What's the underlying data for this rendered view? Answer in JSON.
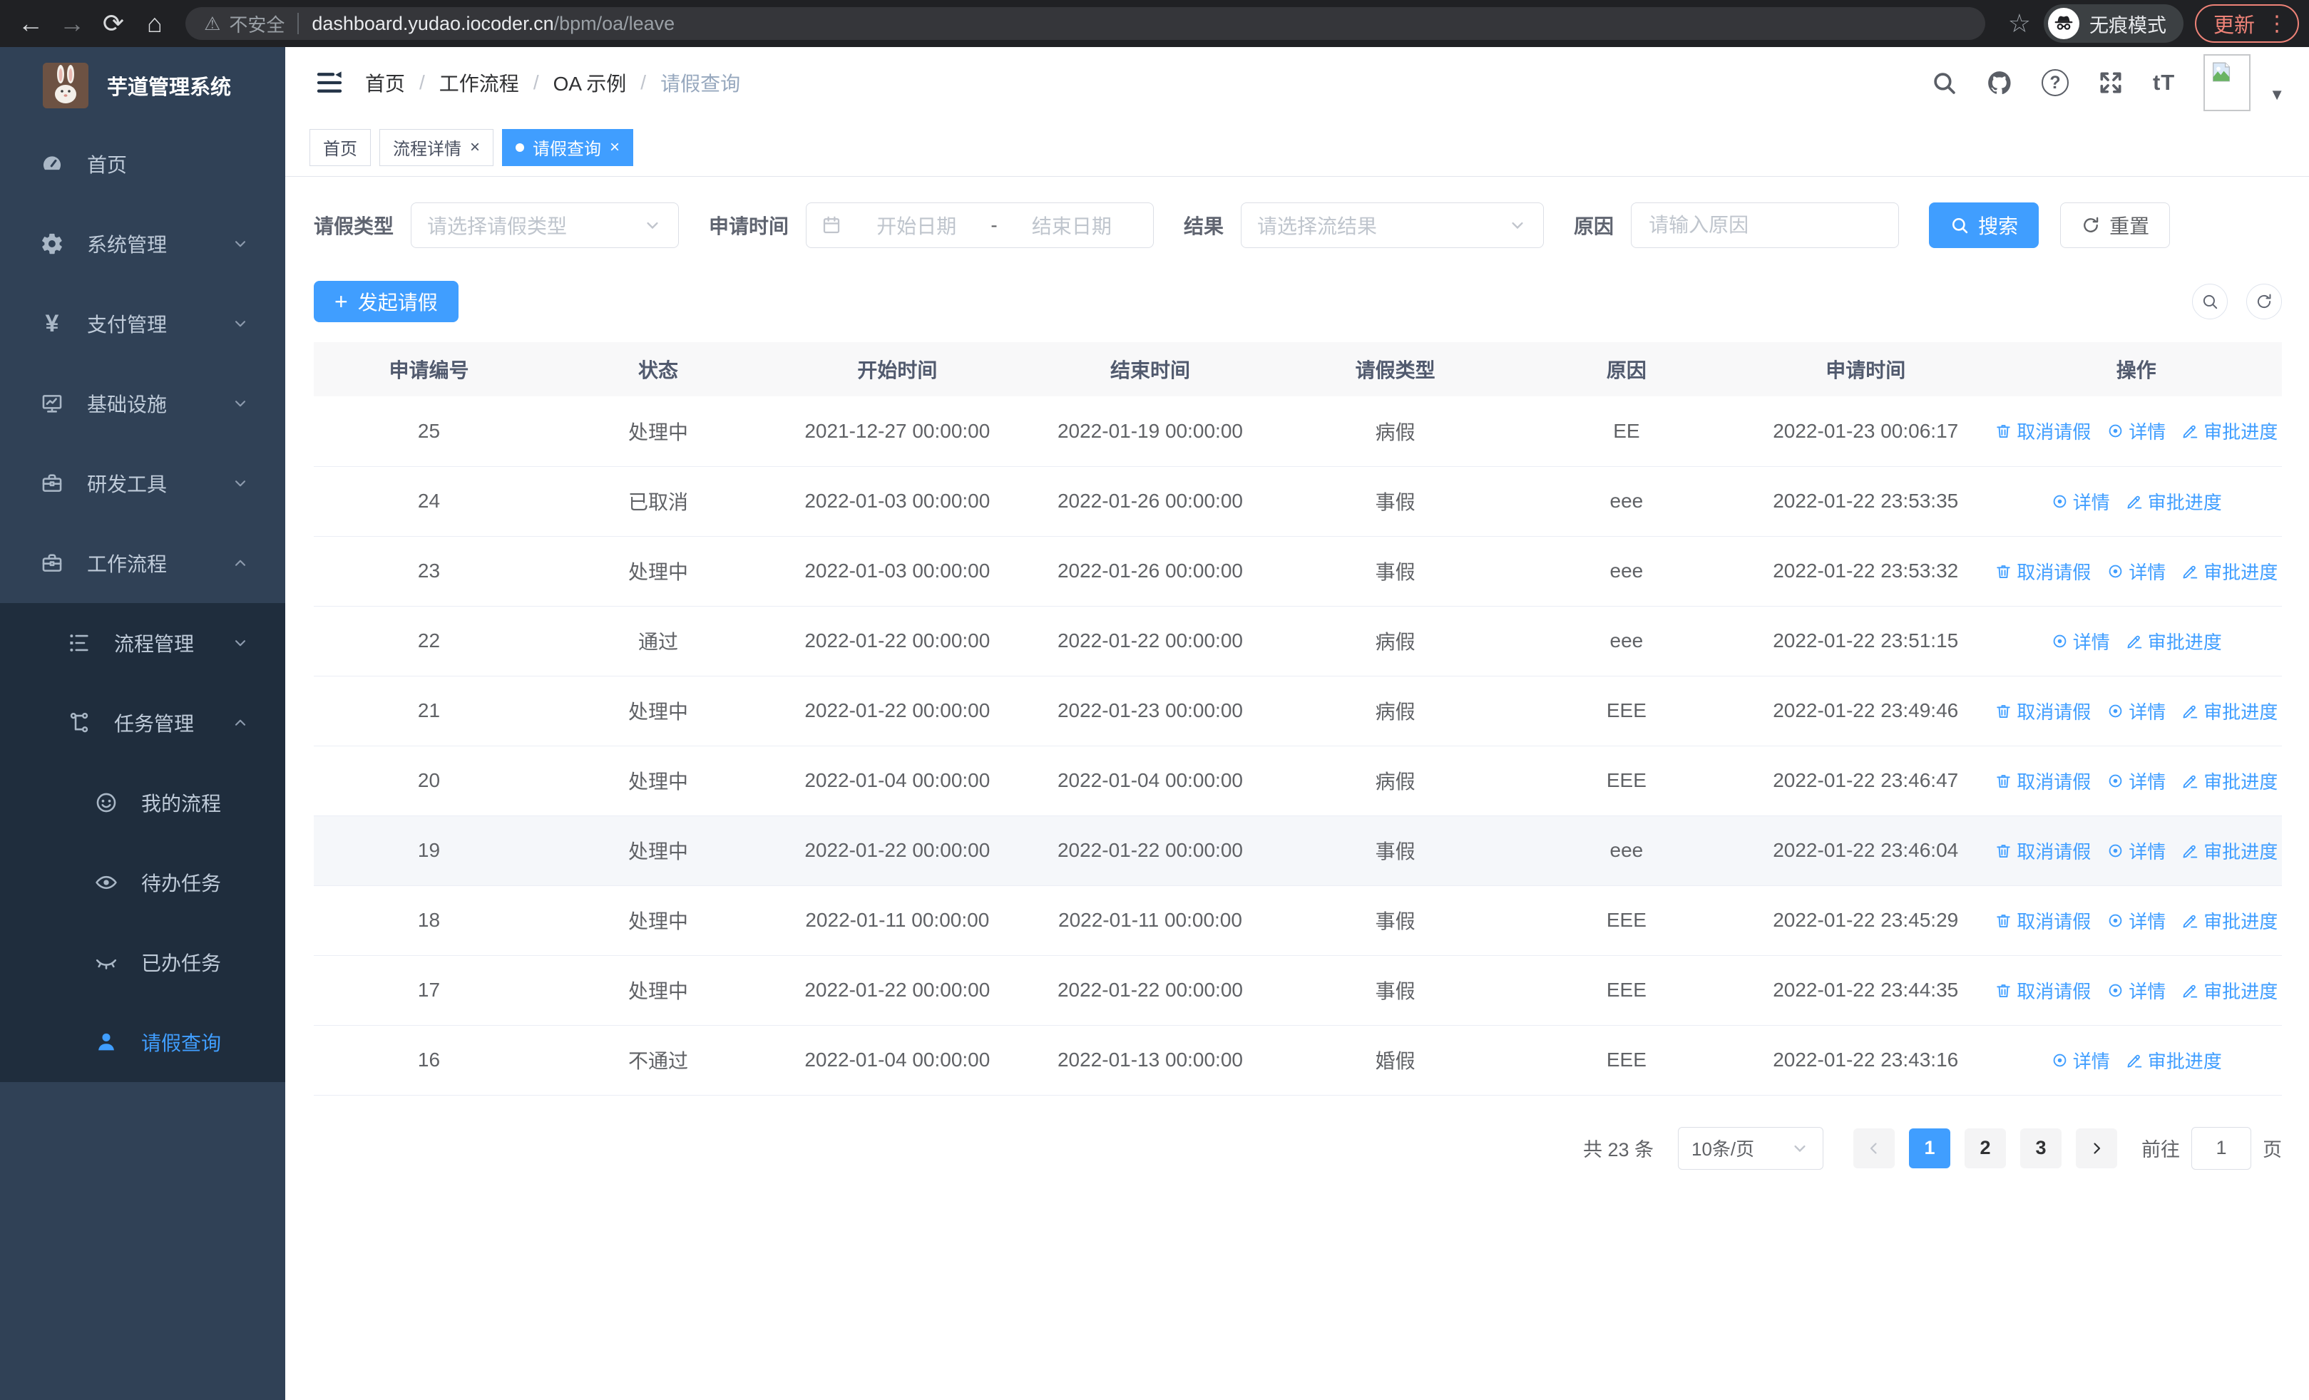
{
  "browser": {
    "security_label": "不安全",
    "url_host": "dashboard.yudao.iocoder.cn",
    "url_path": "/bpm/oa/leave",
    "incognito_label": "无痕模式",
    "update_label": "更新"
  },
  "sidebar": {
    "app_title": "芋道管理系统",
    "menu": [
      {
        "id": "home",
        "label": "首页",
        "icon": "dashboard-icon",
        "level": 0,
        "chev": null,
        "submenu": false,
        "active": false
      },
      {
        "id": "system",
        "label": "系统管理",
        "icon": "gear-icon",
        "level": 0,
        "chev": "down",
        "submenu": false,
        "active": false
      },
      {
        "id": "payment",
        "label": "支付管理",
        "icon": "yen-icon",
        "level": 0,
        "chev": "down",
        "submenu": false,
        "active": false
      },
      {
        "id": "infra",
        "label": "基础设施",
        "icon": "monitor-icon",
        "level": 0,
        "chev": "down",
        "submenu": false,
        "active": false
      },
      {
        "id": "devtools",
        "label": "研发工具",
        "icon": "toolbox-icon",
        "level": 0,
        "chev": "down",
        "submenu": false,
        "active": false
      },
      {
        "id": "workflow",
        "label": "工作流程",
        "icon": "toolbox-icon",
        "level": 0,
        "chev": "up",
        "submenu": false,
        "active": false
      },
      {
        "id": "process-mgmt",
        "label": "流程管理",
        "icon": "tree-icon",
        "level": 1,
        "chev": "down",
        "submenu": true,
        "active": false
      },
      {
        "id": "task-mgmt",
        "label": "任务管理",
        "icon": "share-icon",
        "level": 1,
        "chev": "up",
        "submenu": true,
        "active": false
      },
      {
        "id": "my-process",
        "label": "我的流程",
        "icon": "face-icon",
        "level": 2,
        "chev": null,
        "submenu": true,
        "active": false
      },
      {
        "id": "todo-tasks",
        "label": "待办任务",
        "icon": "eye-icon",
        "level": 2,
        "chev": null,
        "submenu": true,
        "active": false
      },
      {
        "id": "done-tasks",
        "label": "已办任务",
        "icon": "eye-closed-icon",
        "level": 2,
        "chev": null,
        "submenu": true,
        "active": false
      },
      {
        "id": "leave-query",
        "label": "请假查询",
        "icon": "user-icon",
        "level": 2,
        "chev": null,
        "submenu": true,
        "active": true
      }
    ]
  },
  "header": {
    "breadcrumb": [
      "首页",
      "工作流程",
      "OA 示例",
      "请假查询"
    ],
    "help_label": "?",
    "fontsize_label": "tT"
  },
  "tabs": [
    {
      "label": "首页",
      "active": false,
      "closable": false
    },
    {
      "label": "流程详情",
      "active": false,
      "closable": true
    },
    {
      "label": "请假查询",
      "active": true,
      "closable": true
    }
  ],
  "filters": {
    "leave_type_label": "请假类型",
    "leave_type_placeholder": "请选择请假类型",
    "apply_time_label": "申请时间",
    "start_date_placeholder": "开始日期",
    "date_separator": "-",
    "end_date_placeholder": "结束日期",
    "result_label": "结果",
    "result_placeholder": "请选择流结果",
    "reason_label": "原因",
    "reason_placeholder": "请输入原因",
    "search_label": "搜索",
    "reset_label": "重置"
  },
  "toolbar": {
    "create_label": "发起请假"
  },
  "table": {
    "columns": [
      "申请编号",
      "状态",
      "开始时间",
      "结束时间",
      "请假类型",
      "原因",
      "申请时间",
      "操作"
    ],
    "action_labels": {
      "cancel": "取消请假",
      "detail": "详情",
      "progress": "审批进度"
    },
    "rows": [
      {
        "id": "25",
        "status": "处理中",
        "start": "2021-12-27 00:00:00",
        "end": "2022-01-19 00:00:00",
        "type": "病假",
        "reason": "EE",
        "apply_time": "2022-01-23 00:06:17",
        "actions": [
          "cancel",
          "detail",
          "progress"
        ],
        "highlight": false
      },
      {
        "id": "24",
        "status": "已取消",
        "start": "2022-01-03 00:00:00",
        "end": "2022-01-26 00:00:00",
        "type": "事假",
        "reason": "eee",
        "apply_time": "2022-01-22 23:53:35",
        "actions": [
          "detail",
          "progress"
        ],
        "highlight": false
      },
      {
        "id": "23",
        "status": "处理中",
        "start": "2022-01-03 00:00:00",
        "end": "2022-01-26 00:00:00",
        "type": "事假",
        "reason": "eee",
        "apply_time": "2022-01-22 23:53:32",
        "actions": [
          "cancel",
          "detail",
          "progress"
        ],
        "highlight": false
      },
      {
        "id": "22",
        "status": "通过",
        "start": "2022-01-22 00:00:00",
        "end": "2022-01-22 00:00:00",
        "type": "病假",
        "reason": "eee",
        "apply_time": "2022-01-22 23:51:15",
        "actions": [
          "detail",
          "progress"
        ],
        "highlight": false
      },
      {
        "id": "21",
        "status": "处理中",
        "start": "2022-01-22 00:00:00",
        "end": "2022-01-23 00:00:00",
        "type": "病假",
        "reason": "EEE",
        "apply_time": "2022-01-22 23:49:46",
        "actions": [
          "cancel",
          "detail",
          "progress"
        ],
        "highlight": false
      },
      {
        "id": "20",
        "status": "处理中",
        "start": "2022-01-04 00:00:00",
        "end": "2022-01-04 00:00:00",
        "type": "病假",
        "reason": "EEE",
        "apply_time": "2022-01-22 23:46:47",
        "actions": [
          "cancel",
          "detail",
          "progress"
        ],
        "highlight": false
      },
      {
        "id": "19",
        "status": "处理中",
        "start": "2022-01-22 00:00:00",
        "end": "2022-01-22 00:00:00",
        "type": "事假",
        "reason": "eee",
        "apply_time": "2022-01-22 23:46:04",
        "actions": [
          "cancel",
          "detail",
          "progress"
        ],
        "highlight": true
      },
      {
        "id": "18",
        "status": "处理中",
        "start": "2022-01-11 00:00:00",
        "end": "2022-01-11 00:00:00",
        "type": "事假",
        "reason": "EEE",
        "apply_time": "2022-01-22 23:45:29",
        "actions": [
          "cancel",
          "detail",
          "progress"
        ],
        "highlight": false
      },
      {
        "id": "17",
        "status": "处理中",
        "start": "2022-01-22 00:00:00",
        "end": "2022-01-22 00:00:00",
        "type": "事假",
        "reason": "EEE",
        "apply_time": "2022-01-22 23:44:35",
        "actions": [
          "cancel",
          "detail",
          "progress"
        ],
        "highlight": false
      },
      {
        "id": "16",
        "status": "不通过",
        "start": "2022-01-04 00:00:00",
        "end": "2022-01-13 00:00:00",
        "type": "婚假",
        "reason": "EEE",
        "apply_time": "2022-01-22 23:43:16",
        "actions": [
          "detail",
          "progress"
        ],
        "highlight": false
      }
    ]
  },
  "pagination": {
    "total_label": "共 23 条",
    "page_size_label": "10条/页",
    "pages": [
      "1",
      "2",
      "3"
    ],
    "active_page": "1",
    "goto_label": "前往",
    "goto_value": "1",
    "page_unit_label": "页"
  },
  "colors": {
    "accent": "#409eff",
    "sidebar_bg": "#304156",
    "submenu_bg": "#1f2d3d",
    "table_header_bg": "#f8f8f9",
    "update_button": "#ee8277"
  }
}
